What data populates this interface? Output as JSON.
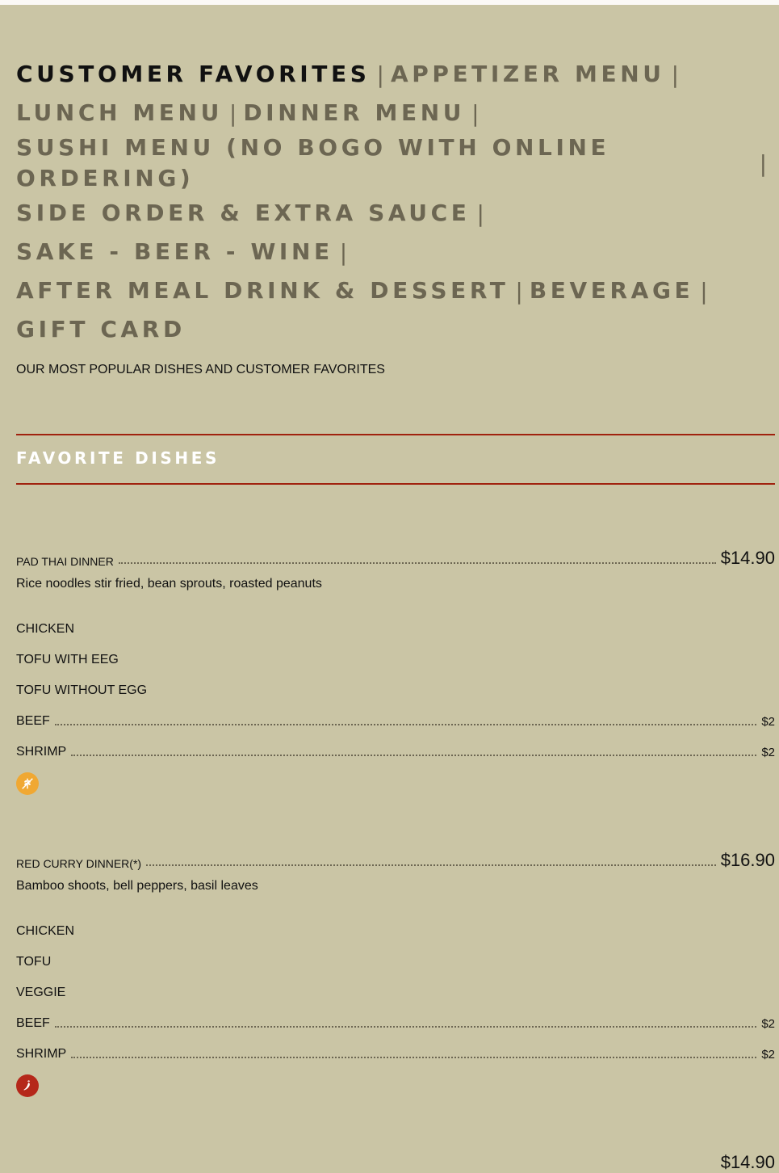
{
  "nav": {
    "customer_favorites": "CUSTOMER FAVORITES",
    "appetizer_menu": "APPETIZER MENU",
    "lunch_menu": "LUNCH MENU",
    "dinner_menu": "DINNER MENU",
    "sushi_menu": "SUSHI MENU (NO BOGO WITH ONLINE ORDERING)",
    "side_order": "SIDE ORDER & EXTRA SAUCE",
    "sake_beer_wine": "SAKE - BEER - WINE",
    "after_meal": "AFTER MEAL DRINK & DESSERT",
    "beverage": "BEVERAGE",
    "gift_card": "GIFT CARD",
    "separator": "|"
  },
  "intro": "OUR MOST POPULAR DISHES AND CUSTOMER FAVORITES",
  "section_title": "FAVORITE DISHES",
  "colors": {
    "background": "#cac5a5",
    "accent_rule": "#a0220e",
    "gluten_badge": "#f0a832",
    "spicy_badge": "#b5281a"
  },
  "dishes": [
    {
      "name": "PAD THAI DINNER",
      "price": "$14.90",
      "description": "Rice noodles stir fried, bean sprouts, roasted peanuts",
      "options": [
        {
          "name": "CHICKEN",
          "price": ""
        },
        {
          "name": "TOFU WITH EEG",
          "price": ""
        },
        {
          "name": "TOFU WITHOUT EGG",
          "price": ""
        },
        {
          "name": "BEEF",
          "price": "$2"
        },
        {
          "name": "SHRIMP",
          "price": "$2"
        }
      ],
      "badge_icon": "gluten-free-icon"
    },
    {
      "name": "RED CURRY DINNER(*)",
      "price": "$16.90",
      "description": "Bamboo shoots, bell peppers, basil leaves",
      "options": [
        {
          "name": "CHICKEN",
          "price": ""
        },
        {
          "name": "TOFU",
          "price": ""
        },
        {
          "name": "VEGGIE",
          "price": ""
        },
        {
          "name": "BEEF",
          "price": "$2"
        },
        {
          "name": "SHRIMP",
          "price": "$2"
        }
      ],
      "badge_icon": "spicy-pepper-icon"
    },
    {
      "name": "",
      "price": "$14.90"
    }
  ]
}
